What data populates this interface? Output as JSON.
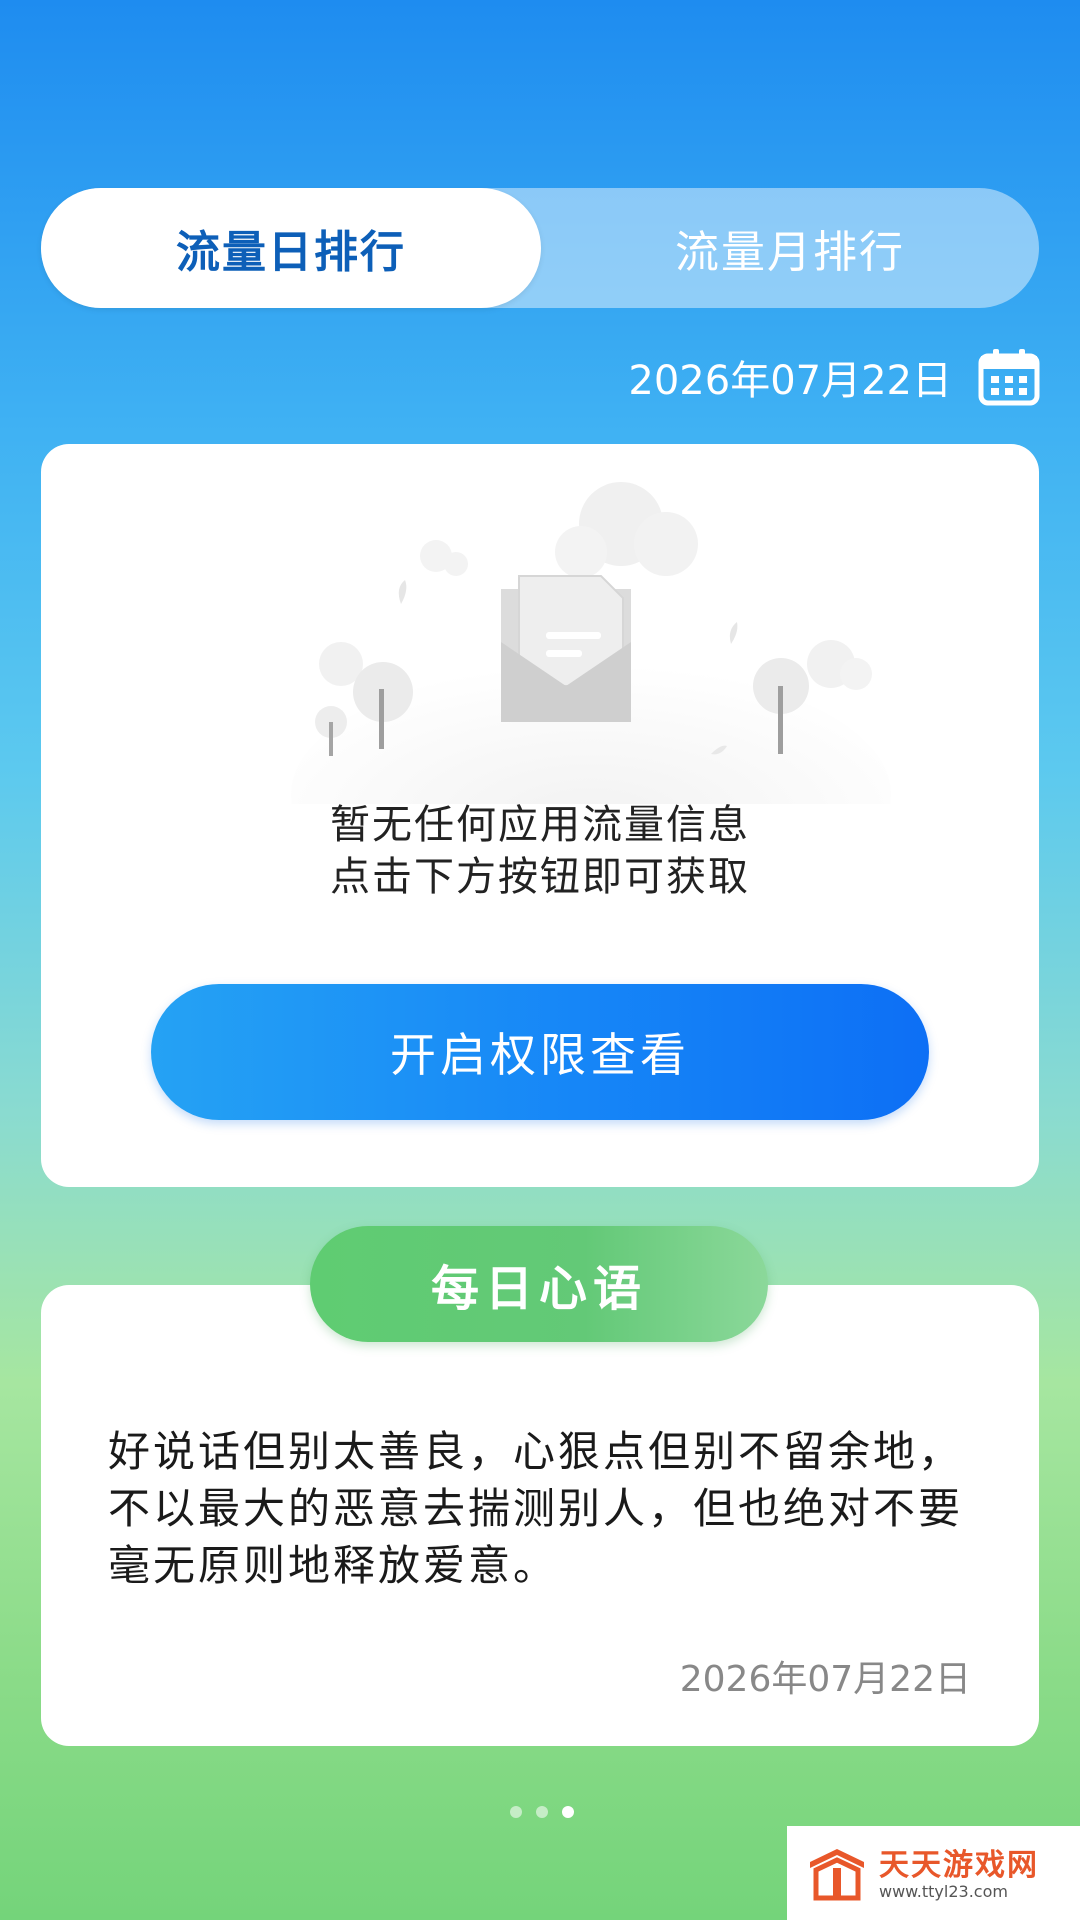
{
  "tabs": {
    "daily": "流量日排行",
    "monthly": "流量月排行"
  },
  "date": {
    "value": "2026年07月22日",
    "icon": "calendar-icon"
  },
  "empty_state": {
    "line1": "暂无任何应用流量信息",
    "line2": "点击下方按钮即可获取",
    "illustration": "empty-inbox-illustration"
  },
  "permission_button": "开启权限查看",
  "daily_quote": {
    "badge": "每日心语",
    "text": "好说话但别太善良，心狠点但别不留余地，不以最大的恶意去揣测别人，但也绝对不要毫无原则地释放爱意。",
    "date": "2026年07月22日"
  },
  "pager": {
    "count": 3,
    "active_index": 2
  },
  "watermark": {
    "name": "天天游戏网",
    "url": "www.ttyl23.com"
  },
  "colors": {
    "primary_blue": "#0d6ff5",
    "active_tab_text": "#0d5fb8",
    "badge_green": "#5fcc72",
    "watermark_orange": "#e8572a"
  }
}
